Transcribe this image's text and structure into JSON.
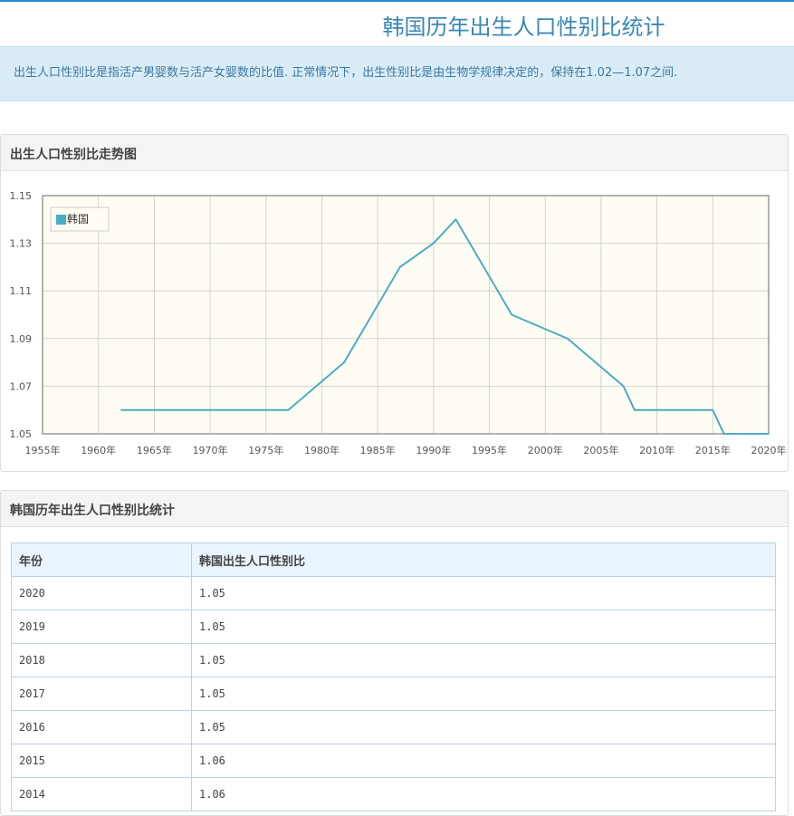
{
  "page": {
    "title": "韩国历年出生人口性别比统计",
    "intro": "出生人口性别比是指活产男婴数与活产女婴数的比值. 正常情况下，出生性别比是由生物学规律决定的，保持在1.02—1.07之间."
  },
  "chart_panel": {
    "title": "出生人口性别比走势图"
  },
  "table_panel": {
    "title": "韩国历年出生人口性别比统计",
    "columns": [
      "年份",
      "韩国出生人口性别比"
    ],
    "rows": [
      [
        "2020",
        "1.05"
      ],
      [
        "2019",
        "1.05"
      ],
      [
        "2018",
        "1.05"
      ],
      [
        "2017",
        "1.05"
      ],
      [
        "2016",
        "1.05"
      ],
      [
        "2015",
        "1.06"
      ],
      [
        "2014",
        "1.06"
      ]
    ]
  },
  "chart_data": {
    "type": "line",
    "legend_position": "top-left",
    "grid": true,
    "xlim": [
      1955,
      2020
    ],
    "ylim": [
      1.05,
      1.15
    ],
    "x_ticks": [
      "1955年",
      "1960年",
      "1965年",
      "1970年",
      "1975年",
      "1980年",
      "1985年",
      "1990年",
      "1995年",
      "2000年",
      "2005年",
      "2010年",
      "2015年",
      "2020年"
    ],
    "y_ticks": [
      "1.15",
      "1.13",
      "1.11",
      "1.09",
      "1.07",
      "1.05"
    ],
    "series": [
      {
        "name": "韩国",
        "color": "#4bacc6",
        "points": [
          [
            1962,
            1.06
          ],
          [
            1967,
            1.06
          ],
          [
            1972,
            1.06
          ],
          [
            1977,
            1.06
          ],
          [
            1982,
            1.08
          ],
          [
            1987,
            1.12
          ],
          [
            1990,
            1.13
          ],
          [
            1992,
            1.14
          ],
          [
            1997,
            1.1
          ],
          [
            2002,
            1.09
          ],
          [
            2007,
            1.07
          ],
          [
            2008,
            1.06
          ],
          [
            2009,
            1.06
          ],
          [
            2010,
            1.06
          ],
          [
            2011,
            1.06
          ],
          [
            2012,
            1.06
          ],
          [
            2013,
            1.06
          ],
          [
            2014,
            1.06
          ],
          [
            2015,
            1.06
          ],
          [
            2016,
            1.05
          ],
          [
            2017,
            1.05
          ],
          [
            2018,
            1.05
          ],
          [
            2019,
            1.05
          ],
          [
            2020,
            1.05
          ]
        ]
      }
    ]
  }
}
